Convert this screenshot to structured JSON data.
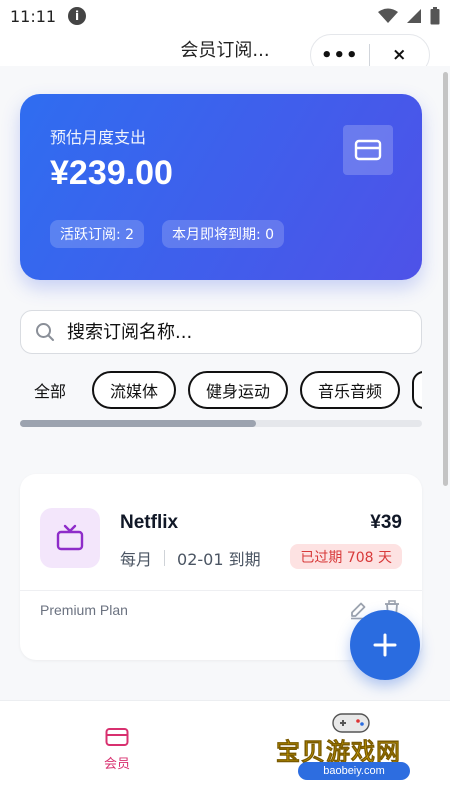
{
  "status_bar": {
    "time": "11:11",
    "info_glyph": "i"
  },
  "nav": {
    "title": "会员订阅...",
    "more_label": "•••",
    "close_label": "×"
  },
  "summary": {
    "label": "预估月度支出",
    "amount": "¥239.00",
    "active_label": "活跃订阅: 2",
    "expiring_label": "本月即将到期: 0"
  },
  "search": {
    "placeholder": "搜索订阅名称..."
  },
  "filters": {
    "all": "全部",
    "chips": [
      "流媒体",
      "健身运动",
      "音乐音频"
    ]
  },
  "subscriptions": [
    {
      "name": "Netflix",
      "price": "¥39",
      "cycle": "每月",
      "due": "02-01 到期",
      "status": "已过期 708 天",
      "plan": "Premium Plan"
    }
  ],
  "fab": {
    "label": "+"
  },
  "tabbar": {
    "member_label": "会员"
  },
  "watermark": {
    "text": "宝贝游戏网",
    "url": "baobeiy.com"
  },
  "colors": {
    "card_gradient_start": "#2f6df0",
    "card_gradient_end": "#4e52e8",
    "fab": "#2a6ce0",
    "tab_active": "#d8306f",
    "expired_bg": "#fde2e2",
    "expired_text": "#d83a3a",
    "icon_purple": "#8e2cc9"
  }
}
